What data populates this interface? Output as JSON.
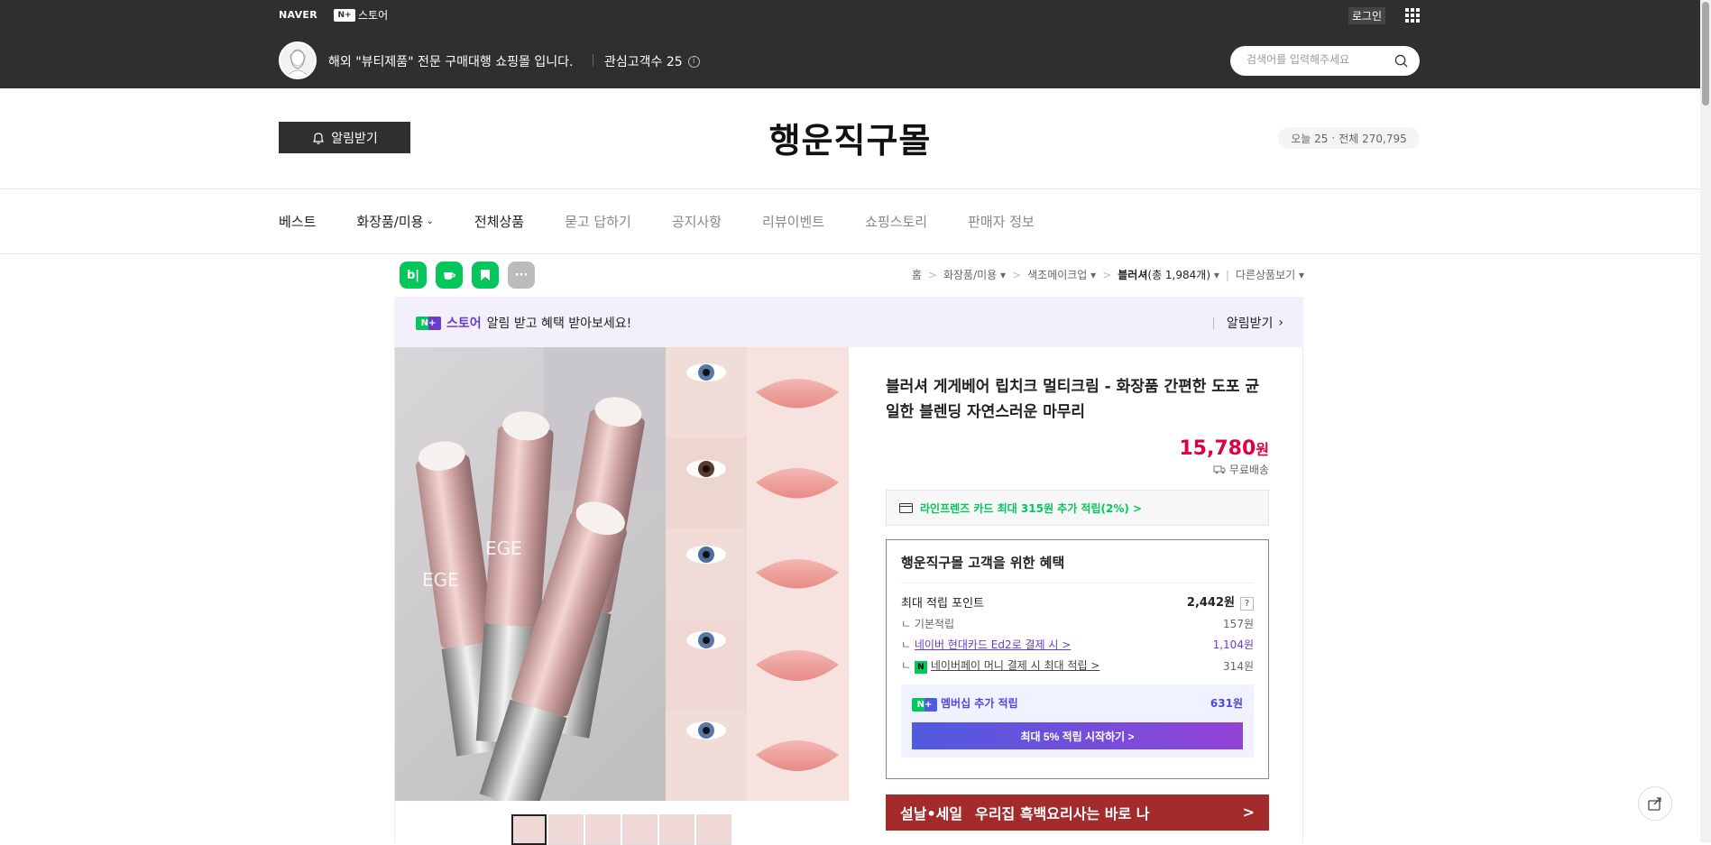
{
  "topbar": {
    "naver_logo": "NAVER",
    "store_logo_badge": "N+",
    "store_logo_text": "스토어",
    "login": "로그인",
    "menu_icon": "grid-icon",
    "store_desc": "해외 \"뷰티제품\" 전문 구매대행 쇼핑몰 입니다.",
    "interest_label": "관심고객수 25",
    "search_placeholder": "검색어를 입력해주세요"
  },
  "header": {
    "alarm_button": "알림받기",
    "store_title": "행운직구몰",
    "visits_today": "오늘 25",
    "visits_total": "전체 270,795"
  },
  "nav": {
    "items": [
      "베스트",
      "화장품/미용",
      "전체상품",
      "묻고 답하기",
      "공지사항",
      "리뷰이벤트",
      "쇼핑스토리",
      "판매자 정보"
    ]
  },
  "share": {
    "icons": [
      "blog-icon",
      "cafe-icon",
      "bookmark-icon",
      "more-icon"
    ],
    "blog": "b|",
    "more": "···"
  },
  "breadcrumb": {
    "items": [
      "홈",
      "화장품/미용",
      "색조메이크업",
      "블러셔"
    ],
    "count": "(총 1,984개)",
    "other": "다른상품보기"
  },
  "promo": {
    "badge": "N+",
    "store": "스토어",
    "text": "알림 받고 혜택 받아보세요!",
    "action": "알림받기"
  },
  "product": {
    "name": "블러셔 게게베어 립치크 멀티크림 - 화장품 간편한 도포 균일한 블렌딩 자연스러운 마무리",
    "price": "15,780",
    "price_unit": "원",
    "shipping": "무료배송",
    "card_benefit": "라인프렌즈 카드 최대 315원 추가 적립(2%) >",
    "brand_text": "EGE"
  },
  "benefit": {
    "title": "행운직구몰 고객을 위한 혜택",
    "max_point_label": "최대 적립 포인트",
    "max_point_value": "2,442원",
    "help": "?",
    "basic_label": "ㄴ 기본적립",
    "basic_value": "157원",
    "hyundai_label": "네이버 현대카드 Ed2로 결제 시 >",
    "hyundai_value": "1,104원",
    "npay_badge": "N",
    "npay_label": "네이버페이 머니 결제 시 최대 적립 >",
    "npay_value": "314원",
    "member_badge": "N+",
    "member_label": "멤버십 추가 적립",
    "member_value": "631원",
    "member_button": "최대 5% 적립 시작하기 >"
  },
  "sale_banner": {
    "tag": "설날•세일",
    "text": "우리집 흑백요리사는 바로 나",
    "arrow": ">"
  }
}
